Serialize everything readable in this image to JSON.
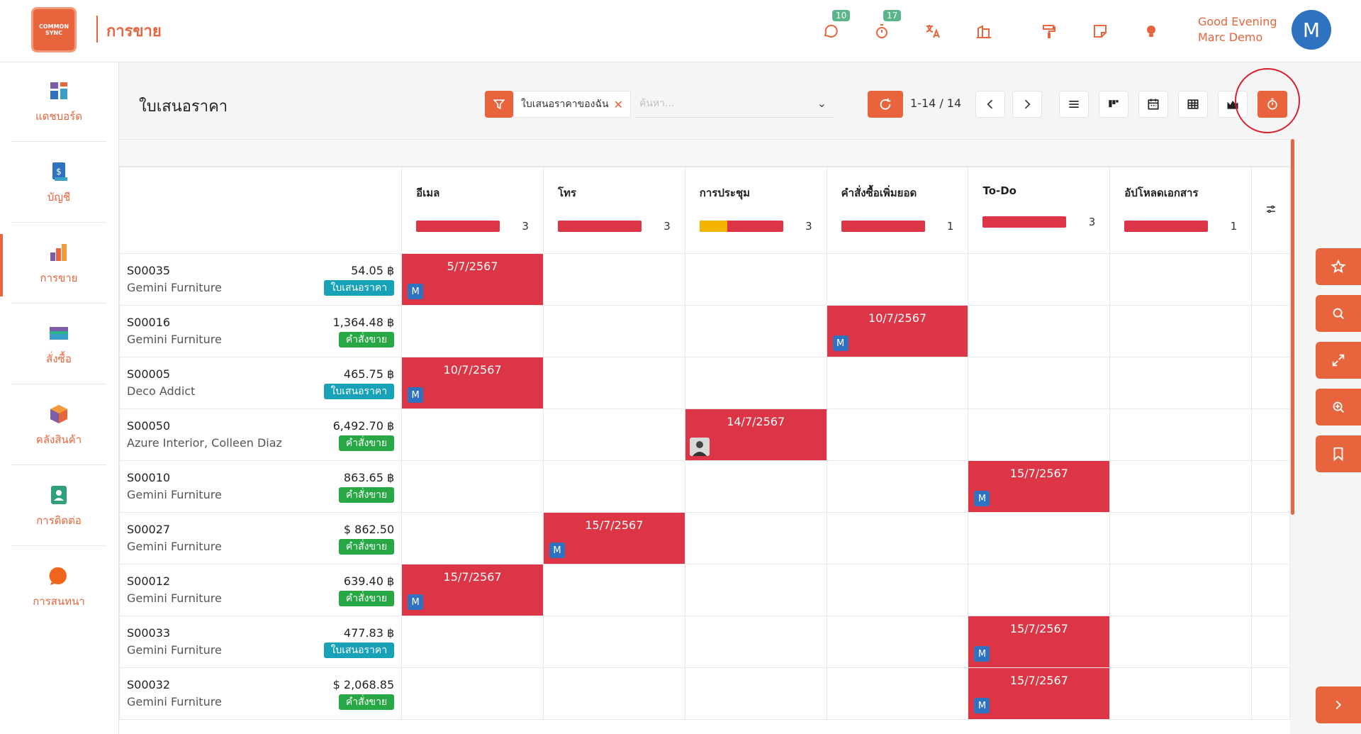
{
  "app": {
    "logo_text": "COMMON SYNC",
    "title": "การขาย"
  },
  "topbar": {
    "chat_badge": "10",
    "timer_badge": "17",
    "greeting_line1": "Good Evening",
    "greeting_line2": "Marc Demo",
    "avatar_letter": "M"
  },
  "sidebar": {
    "items": [
      {
        "label": "แดชบอร์ด"
      },
      {
        "label": "บัญชี"
      },
      {
        "label": "การขาย"
      },
      {
        "label": "สั่งซื้อ"
      },
      {
        "label": "คลังสินค้า"
      },
      {
        "label": "การติดต่อ"
      },
      {
        "label": "การสนทนา"
      }
    ]
  },
  "control": {
    "title": "ใบเสนอราคา",
    "facet": "ใบเสนอราคาของฉัน",
    "search_placeholder": "ค้นหา...",
    "pager": "1-14 / 14"
  },
  "columns": [
    {
      "label": "อีเมล",
      "count": "3",
      "overdue": 0
    },
    {
      "label": "โทร",
      "count": "3",
      "overdue": 0
    },
    {
      "label": "การประชุม",
      "count": "3",
      "overdue": 0.33
    },
    {
      "label": "คำสั่งซื้อเพิ่มยอด",
      "count": "1",
      "overdue": 0
    },
    {
      "label": "To-Do",
      "count": "3",
      "overdue": 0
    },
    {
      "label": "อัปโหลดเอกสาร",
      "count": "1",
      "overdue": 0
    }
  ],
  "rows": [
    {
      "name": "S00035",
      "partner": "Gemini Furniture",
      "amount": "54.05 ฿",
      "tag": "ใบเสนอราคา",
      "tag_color": "#17a2b8",
      "col": 0,
      "date": "5/7/2567",
      "who": "M"
    },
    {
      "name": "S00016",
      "partner": "Gemini Furniture",
      "amount": "1,364.48 ฿",
      "tag": "คำสั่งขาย",
      "tag_color": "#28a745",
      "col": 3,
      "date": "10/7/2567",
      "who": "M"
    },
    {
      "name": "S00005",
      "partner": "Deco Addict",
      "amount": "465.75 ฿",
      "tag": "ใบเสนอราคา",
      "tag_color": "#17a2b8",
      "col": 0,
      "date": "10/7/2567",
      "who": "M"
    },
    {
      "name": "S00050",
      "partner": "Azure Interior, Colleen Diaz",
      "amount": "6,492.70 ฿",
      "tag": "คำสั่งขาย",
      "tag_color": "#28a745",
      "col": 2,
      "date": "14/7/2567",
      "who": "photo"
    },
    {
      "name": "S00010",
      "partner": "Gemini Furniture",
      "amount": "863.65 ฿",
      "tag": "คำสั่งขาย",
      "tag_color": "#28a745",
      "col": 4,
      "date": "15/7/2567",
      "who": "M"
    },
    {
      "name": "S00027",
      "partner": "Gemini Furniture",
      "amount": "$ 862.50",
      "tag": "คำสั่งขาย",
      "tag_color": "#28a745",
      "col": 1,
      "date": "15/7/2567",
      "who": "M"
    },
    {
      "name": "S00012",
      "partner": "Gemini Furniture",
      "amount": "639.40 ฿",
      "tag": "คำสั่งขาย",
      "tag_color": "#28a745",
      "col": 0,
      "date": "15/7/2567",
      "who": "M"
    },
    {
      "name": "S00033",
      "partner": "Gemini Furniture",
      "amount": "477.83 ฿",
      "tag": "ใบเสนอราคา",
      "tag_color": "#17a2b8",
      "col": 4,
      "date": "15/7/2567",
      "who": "M"
    },
    {
      "name": "S00032",
      "partner": "Gemini Furniture",
      "amount": "$ 2,068.85",
      "tag": "คำสั่งขาย",
      "tag_color": "#28a745",
      "col": 4,
      "date": "15/7/2567",
      "who": "M"
    }
  ],
  "colors": {
    "accent": "#e8643c",
    "activity": "#dc3545",
    "warning": "#f5b301",
    "quotation_tag": "#17a2b8",
    "order_tag": "#28a745"
  }
}
